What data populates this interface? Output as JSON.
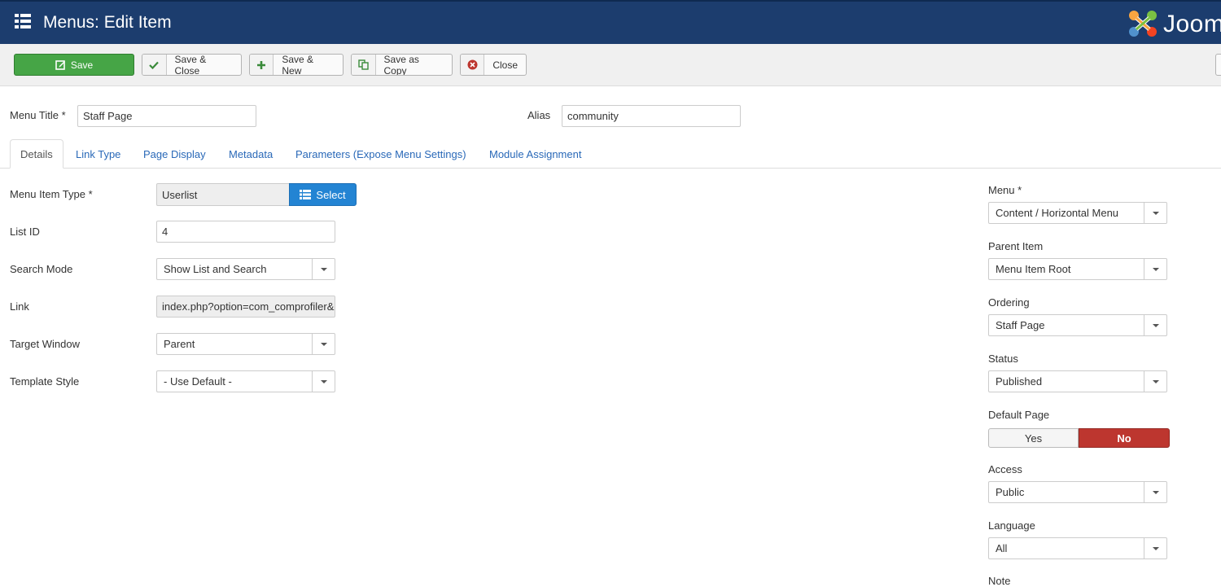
{
  "header": {
    "title": "Menus: Edit Item",
    "logo_text": "Joom"
  },
  "toolbar": {
    "save": "Save",
    "save_close": "Save & Close",
    "save_new": "Save & New",
    "save_copy": "Save as Copy",
    "close": "Close"
  },
  "title_row": {
    "menu_title_label": "Menu Title *",
    "menu_title_value": "Staff Page",
    "alias_label": "Alias",
    "alias_value": "community"
  },
  "tabs": [
    "Details",
    "Link Type",
    "Page Display",
    "Metadata",
    "Parameters (Expose Menu Settings)",
    "Module Assignment"
  ],
  "details": {
    "menu_item_type_label": "Menu Item Type *",
    "menu_item_type_value": "Userlist",
    "select_label": "Select",
    "list_id_label": "List ID",
    "list_id_value": "4",
    "search_mode_label": "Search Mode",
    "search_mode_value": "Show List and Search",
    "link_label": "Link",
    "link_value": "index.php?option=com_comprofiler&",
    "target_window_label": "Target Window",
    "target_window_value": "Parent",
    "template_style_label": "Template Style",
    "template_style_value": "- Use Default -"
  },
  "sidebar": {
    "menu_label": "Menu *",
    "menu_value": "Content / Horizontal Menu",
    "parent_label": "Parent Item",
    "parent_value": "Menu Item Root",
    "ordering_label": "Ordering",
    "ordering_value": "Staff Page",
    "status_label": "Status",
    "status_value": "Published",
    "default_label": "Default Page",
    "default_yes": "Yes",
    "default_no": "No",
    "access_label": "Access",
    "access_value": "Public",
    "language_label": "Language",
    "language_value": "All",
    "note_label": "Note"
  },
  "colors": {
    "header": "#1c3d6e",
    "save": "#46a546",
    "select_btn": "#2384d3",
    "no_active": "#bd362f"
  }
}
